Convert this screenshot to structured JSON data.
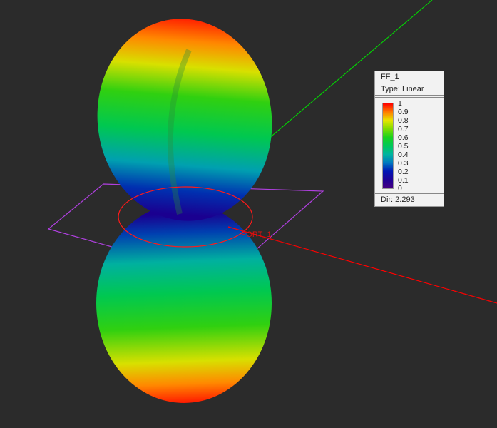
{
  "legend": {
    "title": "FF_1",
    "type": "Type: Linear",
    "ticks": [
      "1",
      "0.9",
      "0.8",
      "0.7",
      "0.6",
      "0.5",
      "0.4",
      "0.3",
      "0.2",
      "0.1",
      "0"
    ],
    "directivity": "Dir: 2.293",
    "colormap": [
      "#ff0000",
      "#ff7a00",
      "#e6e600",
      "#7fdc00",
      "#19d21e",
      "#00c85a",
      "#00b4a0",
      "#0078c0",
      "#0014b4",
      "#1e0096",
      "#460082"
    ]
  },
  "scene": {
    "port_label": "PORT_1",
    "axis_colors": {
      "x": "#ff0000",
      "y": "#00e000",
      "plane": "#b040e0"
    }
  }
}
